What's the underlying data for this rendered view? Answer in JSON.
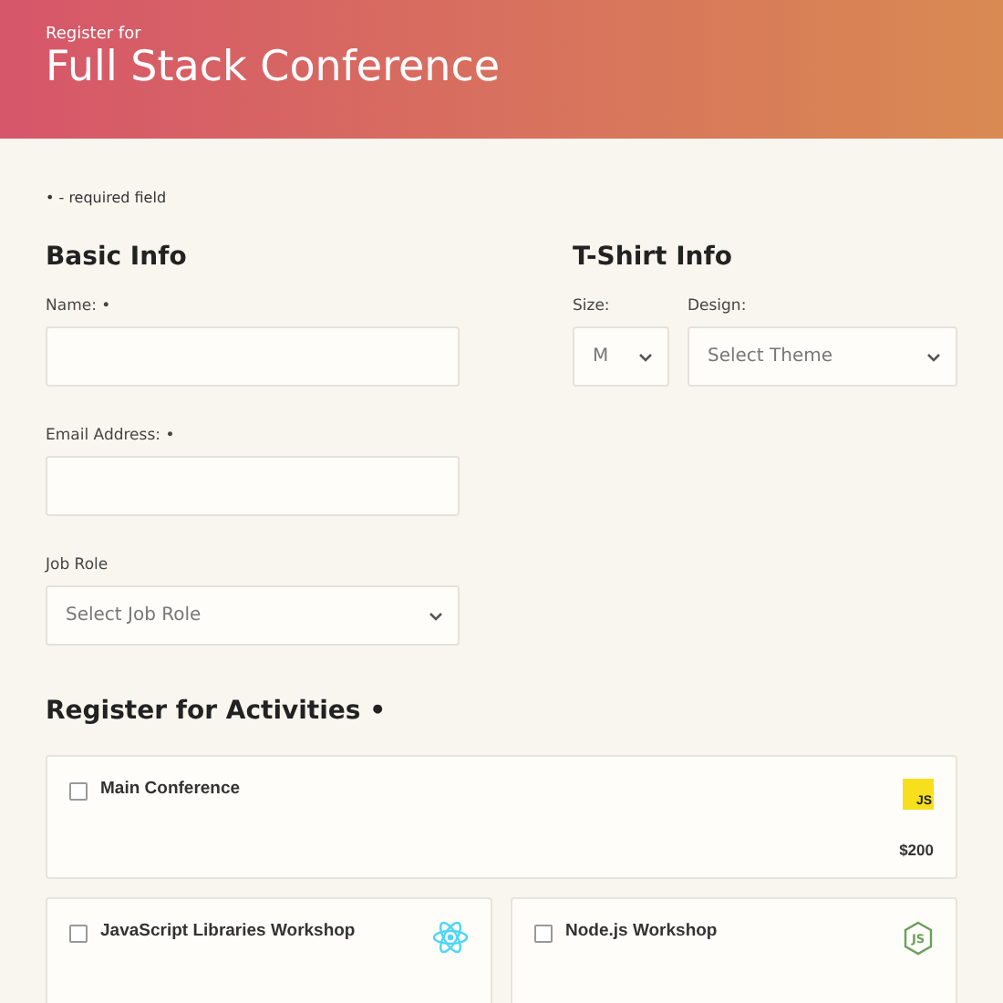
{
  "header": {
    "eyebrow": "Register for",
    "title": "Full Stack Conference"
  },
  "legend": "• - required field",
  "basic_info": {
    "heading": "Basic Info",
    "fields": [
      {
        "kind": "input",
        "label": "Name: •"
      },
      {
        "kind": "input",
        "label": "Email Address: •"
      },
      {
        "kind": "select",
        "label": "Job Role",
        "value": "Select Job Role"
      }
    ]
  },
  "tshirt_info": {
    "heading": "T-Shirt Info",
    "fields": [
      {
        "kind": "select",
        "label": "Size:",
        "value": "M"
      },
      {
        "kind": "select",
        "label": "Design:",
        "value": "Select Theme"
      }
    ]
  },
  "activities": {
    "heading": "Register for Activities •",
    "items": [
      {
        "name": "Main Conference",
        "checked": false,
        "kind": "js",
        "logo_text": "JS",
        "price": "$200"
      },
      {
        "name": "JavaScript Libraries Workshop",
        "checked": false,
        "kind": "atom"
      },
      {
        "name": "Node.js Workshop",
        "checked": false,
        "kind": "hexagon",
        "logo_text": "JS"
      }
    ]
  }
}
